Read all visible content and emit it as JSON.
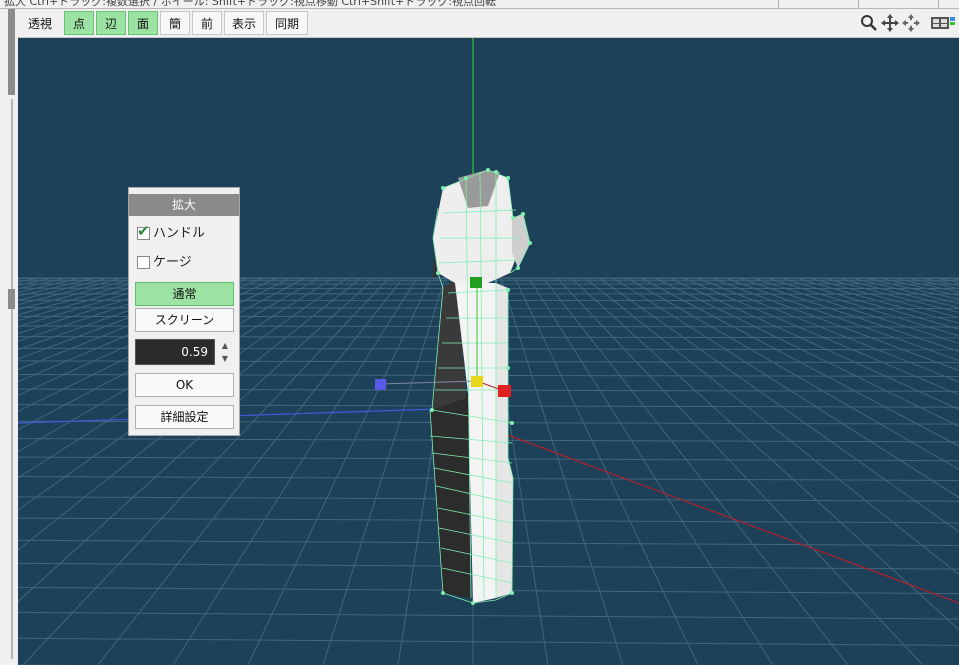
{
  "status": {
    "text": "拡大 Ctrl+ドラッグ:複数選択 / ホイール: Shift+ドラッグ:視点移動 Ctrl+Shift+ドラッグ:視点回転"
  },
  "toolbar": {
    "buttons": [
      {
        "label": "透視",
        "active": false
      },
      {
        "label": "点",
        "active": true
      },
      {
        "label": "辺",
        "active": true
      },
      {
        "label": "面",
        "active": true
      },
      {
        "label": "簡",
        "active": false
      },
      {
        "label": "前",
        "active": false
      },
      {
        "label": "表示",
        "active": false
      },
      {
        "label": "同期",
        "active": false
      }
    ],
    "icons": [
      "zoom-icon",
      "move-icon",
      "rotate-icon",
      "display-icon"
    ]
  },
  "panel": {
    "title": "拡大",
    "handle": {
      "label": "ハンドル",
      "checked": true
    },
    "cage": {
      "label": "ケージ",
      "checked": false
    },
    "mode_normal": "通常",
    "mode_screen": "スクリーン",
    "value": "0.59",
    "ok": "OK",
    "details": "詳細設定"
  },
  "colors": {
    "background": "#1d4159",
    "grid": "#4d7388",
    "accent": "#9ce3a3",
    "axis_x": "#b0202a",
    "axis_y": "#2ec82e",
    "axis_z": "#3b5bdc"
  }
}
